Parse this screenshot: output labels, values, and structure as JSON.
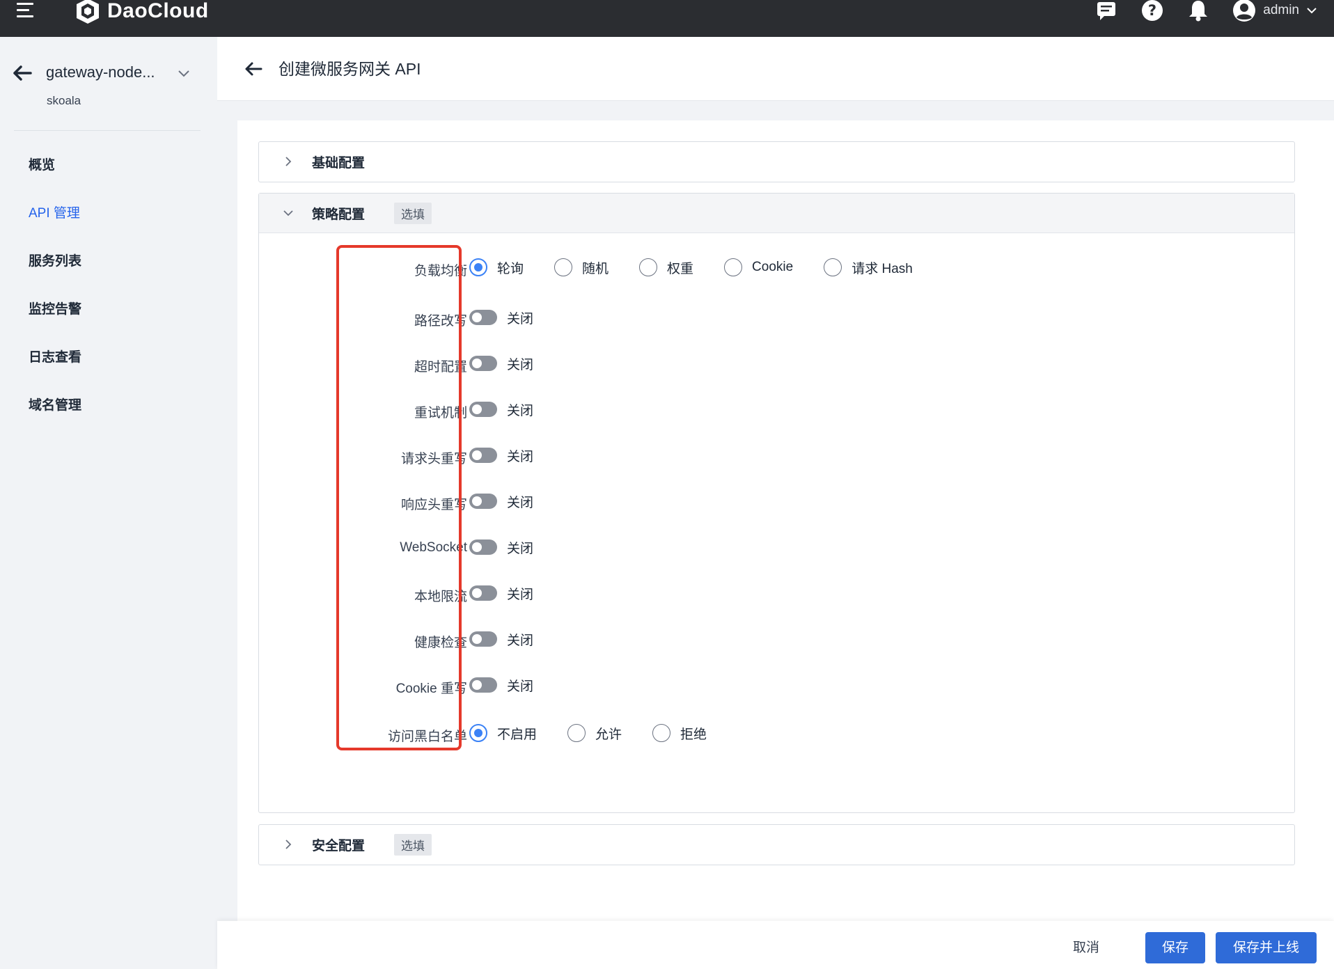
{
  "topbar": {
    "brand": "DaoCloud",
    "user": "admin"
  },
  "sidebar": {
    "gateway_name": "gateway-node...",
    "namespace": "skoala",
    "items": [
      {
        "label": "概览"
      },
      {
        "label": "API 管理"
      },
      {
        "label": "服务列表"
      },
      {
        "label": "监控告警"
      },
      {
        "label": "日志查看"
      },
      {
        "label": "域名管理"
      }
    ]
  },
  "header": {
    "title": "创建微服务网关 API"
  },
  "sections": {
    "basic": {
      "title": "基础配置"
    },
    "policy": {
      "title": "策略配置",
      "tag": "选填"
    },
    "security": {
      "title": "安全配置",
      "tag": "选填"
    }
  },
  "policy": {
    "load_balance": {
      "label": "负载均衡",
      "options": [
        "轮询",
        "随机",
        "权重",
        "Cookie",
        "请求 Hash"
      ],
      "selected": "轮询"
    },
    "toggles": [
      {
        "label": "路径改写",
        "state": "关闭"
      },
      {
        "label": "超时配置",
        "state": "关闭"
      },
      {
        "label": "重试机制",
        "state": "关闭"
      },
      {
        "label": "请求头重写",
        "state": "关闭"
      },
      {
        "label": "响应头重写",
        "state": "关闭"
      },
      {
        "label": "WebSocket",
        "state": "关闭"
      },
      {
        "label": "本地限流",
        "state": "关闭"
      },
      {
        "label": "健康检查",
        "state": "关闭"
      },
      {
        "label": "Cookie 重写",
        "state": "关闭"
      }
    ],
    "access_list": {
      "label": "访问黑白名单",
      "options": [
        "不启用",
        "允许",
        "拒绝"
      ],
      "selected": "不启用"
    }
  },
  "footer": {
    "cancel": "取消",
    "save": "保存",
    "save_online": "保存并上线"
  },
  "colors": {
    "topbar": "#2b2d31",
    "primary": "#2f6bd8",
    "highlight_box": "#e5392b"
  }
}
